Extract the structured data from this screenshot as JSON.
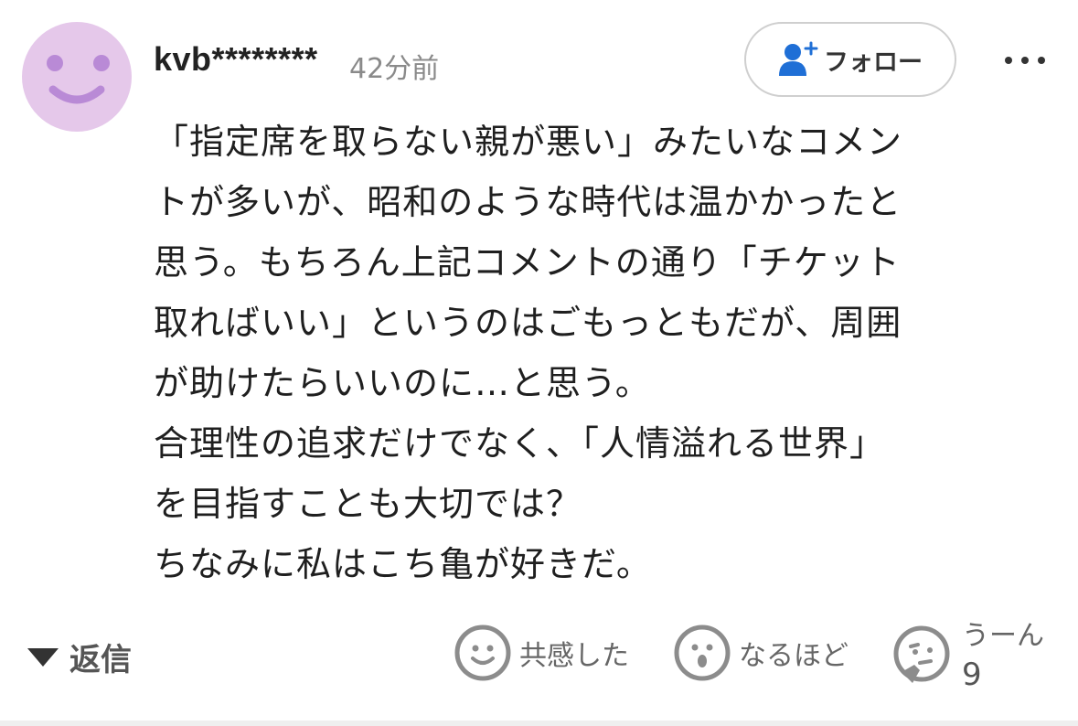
{
  "comment": {
    "username": "kvb********",
    "timestamp": "42分前",
    "follow_label": "フォロー",
    "avatar_color": "#e5c8ea",
    "avatar_face_color": "#b98ad6",
    "body_lines": [
      "「指定席を取らない親が悪い」みたいなコメン",
      "トが多いが、昭和のような時代は温かかったと",
      "思う。もちろん上記コメントの通り「チケット",
      "取ればいい」というのはごもっともだが、周囲",
      "が助けたらいいのに…と思う。",
      "合理性の追求だけでなく、「人情溢れる世界」",
      "を目指すことも大切では？",
      "ちなみに私はこち亀が好きだ。"
    ]
  },
  "actions": {
    "reply_label": "返信",
    "reactions": [
      {
        "icon": "smile-icon",
        "label": "共感した"
      },
      {
        "icon": "surprised-icon",
        "label": "なるほど"
      },
      {
        "icon": "thinking-icon",
        "label": "うーん",
        "count": "9"
      }
    ]
  },
  "icons": {
    "follow": "add-person-icon",
    "more": "more-dots-icon",
    "reply": "triangle-down-icon"
  },
  "colors": {
    "accent_blue": "#1f6fd6",
    "icon_gray": "#8c8c8c"
  }
}
